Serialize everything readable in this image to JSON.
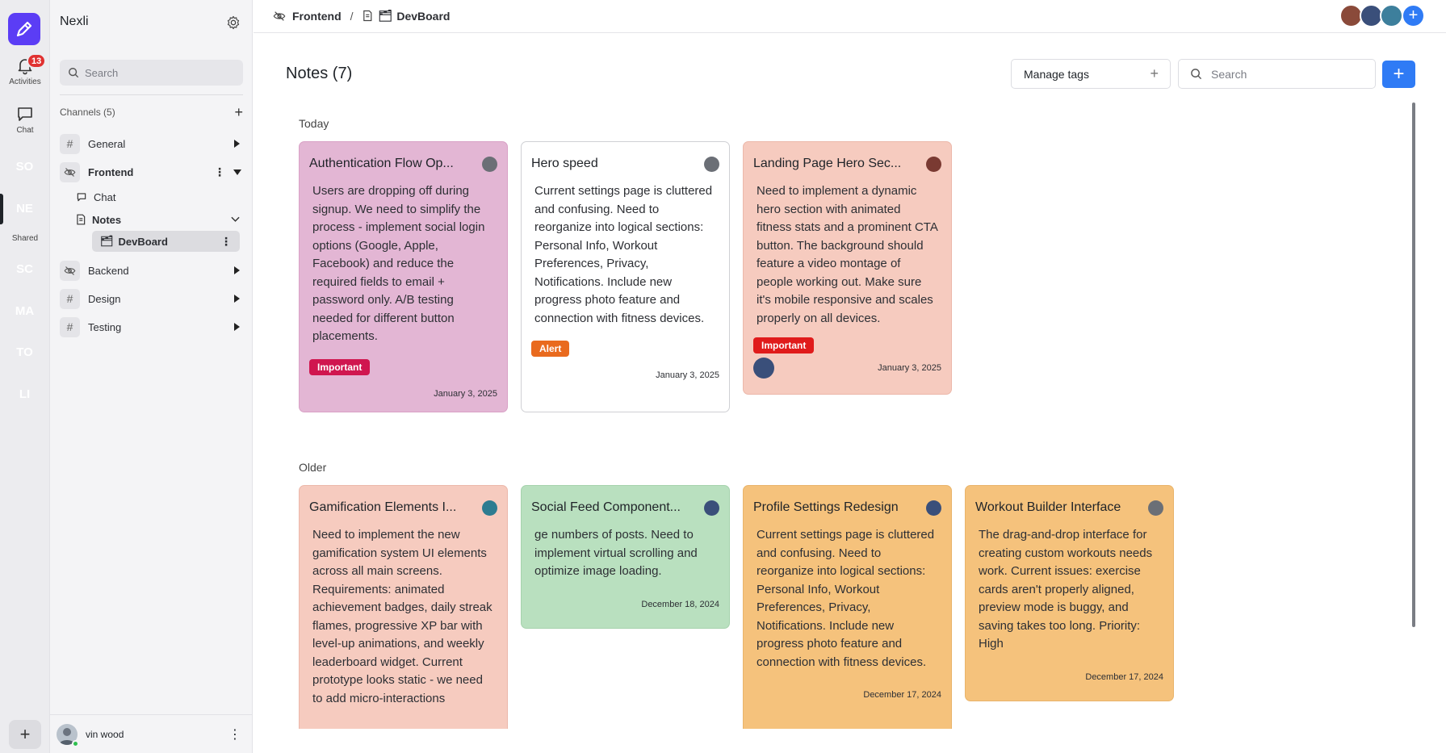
{
  "rail": {
    "activities_label": "Activities",
    "activities_badge": "13",
    "chat_label": "Chat",
    "shared_label": "Shared",
    "workspaces": [
      {
        "initials": "SO",
        "color": "#2ea3f2"
      },
      {
        "initials": "NE",
        "color": "#2d3bd4"
      },
      {
        "initials": "SC",
        "color": "#f77f0a"
      },
      {
        "initials": "MA",
        "color": "#c99314"
      },
      {
        "initials": "TO",
        "color": "#e52222"
      },
      {
        "initials": "LI",
        "color": "#f05a5a"
      }
    ]
  },
  "sidebar": {
    "title": "Nexli",
    "search_placeholder": "Search",
    "channels_header": "Channels (5)",
    "channels": [
      {
        "name": "General",
        "icon": "hash-icon"
      },
      {
        "name": "Frontend",
        "icon": "eye-off-icon"
      },
      {
        "name": "Backend",
        "icon": "eye-off-icon"
      },
      {
        "name": "Design",
        "icon": "hash-icon"
      },
      {
        "name": "Testing",
        "icon": "hash-icon"
      }
    ],
    "frontend_children": {
      "chat": "Chat",
      "notes": "Notes",
      "devboard": "DevBoard"
    },
    "user_name": "vin wood"
  },
  "topbar": {
    "breadcrumb_channel": "Frontend",
    "breadcrumb_separator": "/",
    "breadcrumb_board": "DevBoard",
    "avatar_colors": [
      "#8a4a3a",
      "#3a4f7a",
      "#3d7f9c"
    ]
  },
  "main": {
    "title": "Notes (7)",
    "manage_tags_label": "Manage tags",
    "search_placeholder": "Search",
    "sections": {
      "today": "Today",
      "older": "Older"
    },
    "today_cards": [
      {
        "title": "Authentication Flow Op...",
        "body": "Users are dropping off during signup. We need to simplify the process - implement social login options (Google, Apple,  Facebook) and reduce the required fields to email + password only. A/B testing needed for different button placements.",
        "tag": "Important",
        "tag_color": "#d0164f",
        "date": "January 3, 2025",
        "bg": "#e3b6d4",
        "border": "#d9a1c6",
        "avatar_color": "#6b6f76"
      },
      {
        "title": "Hero speed",
        "body": "Current settings page is cluttered and confusing. Need to reorganize into logical sections: Personal Info, Workout Preferences, Privacy, Notifications. Include new progress photo feature and connection with fitness devices.",
        "tag": "Alert",
        "tag_color": "#e96a1e",
        "date": "January 3, 2025",
        "bg": "#ffffff",
        "border": "#cfd0d4",
        "avatar_color": "#6b6f76"
      },
      {
        "title": "Landing Page Hero Sec...",
        "body": "Need to implement a dynamic hero section with animated fitness stats and a prominent CTA button. The background should feature a video montage of people working out. Make sure it's mobile responsive and scales properly on all devices.",
        "tag": "Important",
        "tag_color": "#e01b1b",
        "date": "January 3, 2025",
        "bg": "#f6cbbf",
        "border": "#ecb8aa",
        "avatar_color": "#7a3a32",
        "footer_avatar_color": "#3a4f7a"
      }
    ],
    "older_cards": [
      {
        "title": "Gamification Elements I...",
        "body": "Need to implement the new gamification system UI elements across all main screens. Requirements: animated achievement badges, daily streak flames, progressive XP bar with level-up animations, and weekly leaderboard widget. Current prototype looks static - we need to add micro-interactions",
        "date": "",
        "bg": "#f6cbbf",
        "border": "#ecb8aa",
        "avatar_color": "#2d7c91"
      },
      {
        "title": "Social Feed Component...",
        "body": "ge numbers of posts. Need to implement virtual scrolling and optimize image loading.",
        "date": "December 18, 2024",
        "bg": "#b9e0bf",
        "border": "#a6d2ad",
        "avatar_color": "#3a4f7a"
      },
      {
        "title": "Profile Settings Redesign",
        "body": "Current settings page is cluttered and confusing. Need to reorganize into logical sections: Personal Info, Workout Preferences, Privacy, Notifications. Include new progress photo feature and connection with fitness devices.",
        "date": "December 17, 2024",
        "bg": "#f5c27c",
        "border": "#e9b46b",
        "avatar_color": "#3a4f7a"
      },
      {
        "title": "Workout Builder Interface",
        "body": "The drag-and-drop interface for creating custom workouts needs work. Current issues: exercise cards aren't properly aligned, preview mode is buggy, and saving takes too long. Priority: High",
        "date": "December 17, 2024",
        "bg": "#f5c27c",
        "border": "#e9b46b",
        "avatar_color": "#6b6f76"
      }
    ]
  },
  "colors": {
    "accent": "#2f7bf5",
    "brand": "#5b3df5"
  }
}
